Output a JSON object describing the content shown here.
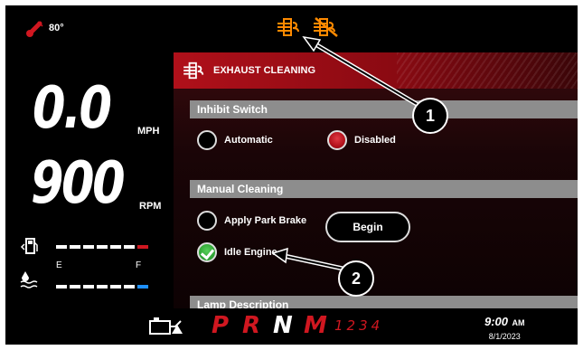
{
  "topbar": {
    "temperature": "80°"
  },
  "speed": {
    "value": "0.0",
    "unit": "MPH"
  },
  "rpm": {
    "value": "900",
    "unit": "RPM"
  },
  "def_gauge": {
    "empty": "E",
    "full": "F"
  },
  "panel": {
    "title": "EXHAUST CLEANING"
  },
  "inhibit": {
    "heading": "Inhibit Switch",
    "options": [
      {
        "label": "Automatic",
        "selected": false
      },
      {
        "label": "Disabled",
        "selected": true
      }
    ]
  },
  "manual": {
    "heading": "Manual Cleaning",
    "conditions": [
      {
        "label": "Apply Park Brake",
        "met": false
      },
      {
        "label": "Idle Engine",
        "met": true
      }
    ],
    "begin_label": "Begin"
  },
  "lamp": {
    "heading": "Lamp Description"
  },
  "gears": {
    "P": "P",
    "R": "R",
    "N": "N",
    "M": "M",
    "numbers": "1234",
    "active": "N"
  },
  "clock": {
    "time": "9:00",
    "ampm": "AM",
    "date": "8/1/2023"
  },
  "callouts": {
    "one": "1",
    "two": "2"
  },
  "colors": {
    "accent_red": "#c8101a",
    "warning_orange": "#ff8a00",
    "check_green": "#3bb33f"
  }
}
